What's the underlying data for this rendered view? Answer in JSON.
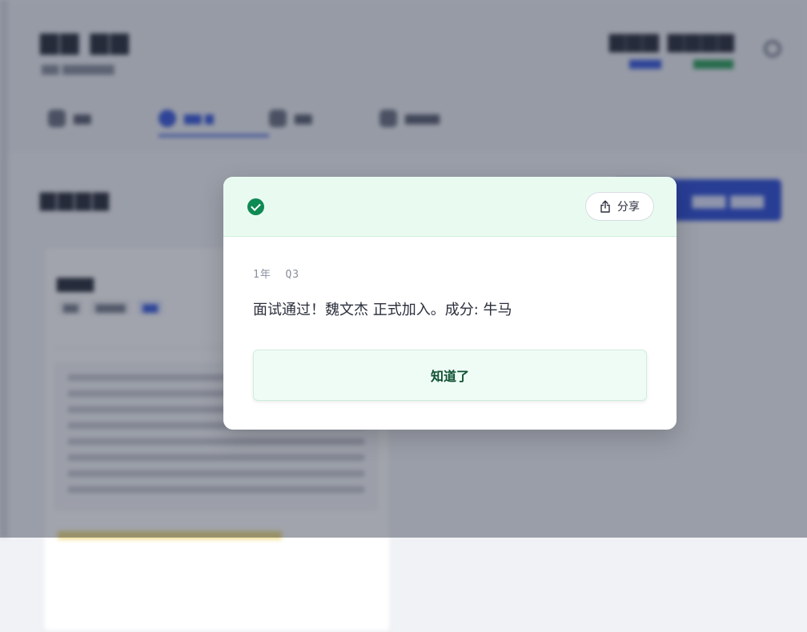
{
  "modal": {
    "status_icon": "check-circle-icon",
    "share_label": "分享",
    "share_icon": "share-icon",
    "meta": "1年  Q3",
    "message": "面试通过！魏文杰 正式加入。成分: 牛马",
    "confirm_label": "知道了",
    "accent_color": "#0e8a53",
    "header_bg": "#e9fbf1"
  }
}
